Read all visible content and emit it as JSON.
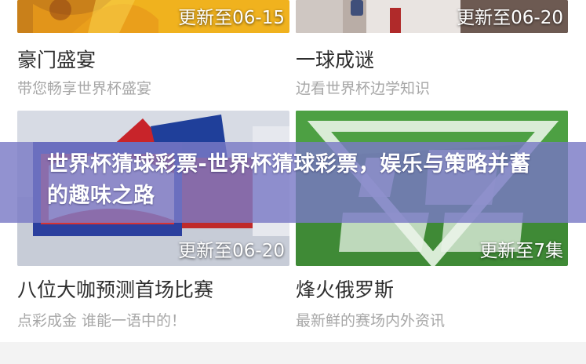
{
  "overlay_title": "世界杯猜球彩票-世界杯猜球彩票，娱乐与策略并蓄的趣味之路",
  "cards": [
    {
      "badge": "更新至06-15",
      "title": "豪门盛宴",
      "subtitle": "带您畅享世界杯盛宴"
    },
    {
      "badge": "更新至06-20",
      "title": "一球成谜",
      "subtitle": "边看世界杯边学知识"
    },
    {
      "badge": "更新至06-20",
      "title": "八位大咖预测首场比赛",
      "subtitle": "点彩成金 谁能一语中的！"
    },
    {
      "badge": "更新至7集",
      "title": "烽火俄罗斯",
      "subtitle": "最新鲜的赛场内外资讯"
    }
  ],
  "colors": {
    "overlay": "#7a7ac6",
    "title_text": "#2e2e2e",
    "subtitle_text": "#a7a7a7"
  }
}
